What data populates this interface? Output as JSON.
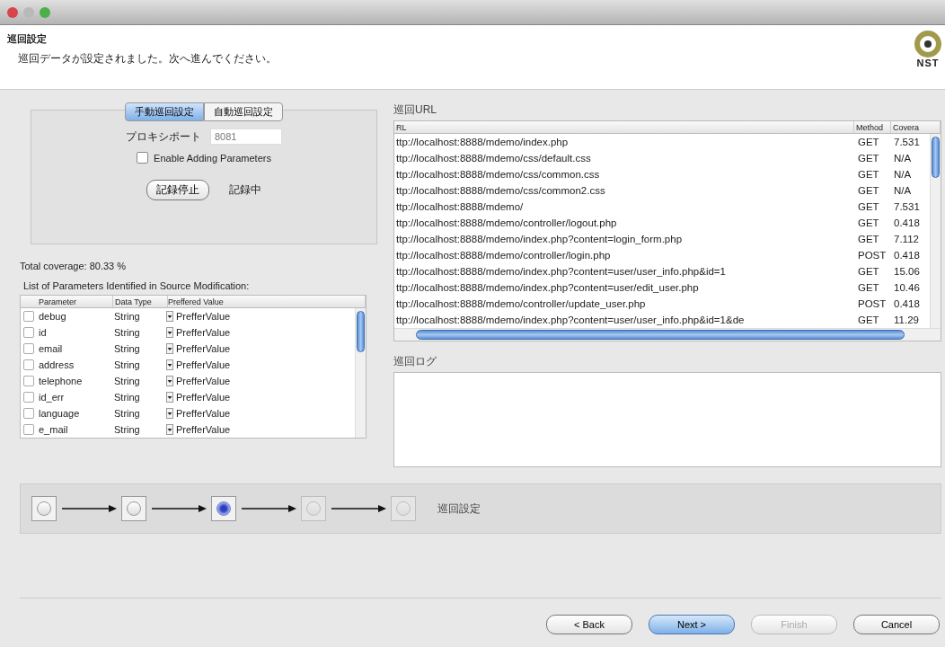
{
  "window": {
    "title_bar_buttons": [
      {
        "kind": "close"
      },
      {
        "kind": "minimize"
      },
      {
        "kind": "zoom"
      }
    ]
  },
  "header": {
    "title": "巡回設定",
    "message": "巡回データが設定されました。次へ進んでください。",
    "logo_text": "NST"
  },
  "tabs": [
    {
      "label": "手動巡回設定",
      "selected": true
    },
    {
      "label": "自動巡回設定",
      "selected": false
    }
  ],
  "proxy": {
    "label": "プロキシポート",
    "value": "8081"
  },
  "enable_params": {
    "label": "Enable Adding Parameters",
    "checked": false
  },
  "record": {
    "button": "記録停止",
    "status": "記録中"
  },
  "total_coverage": "Total coverage: 80.33 %",
  "params_label": "List of Parameters Identified in Source Modification:",
  "params_table": {
    "columns": [
      "Parameter",
      "Data Type",
      "Preffered Value"
    ],
    "rows": [
      {
        "checked": false,
        "name": "debug",
        "type": "String",
        "value": "PrefferValue"
      },
      {
        "checked": false,
        "name": "id",
        "type": "String",
        "value": "PrefferValue"
      },
      {
        "checked": false,
        "name": "email",
        "type": "String",
        "value": "PrefferValue"
      },
      {
        "checked": false,
        "name": "address",
        "type": "String",
        "value": "PrefferValue"
      },
      {
        "checked": false,
        "name": "telephone",
        "type": "String",
        "value": "PrefferValue"
      },
      {
        "checked": false,
        "name": "id_err",
        "type": "String",
        "value": "PrefferValue"
      },
      {
        "checked": false,
        "name": "language",
        "type": "String",
        "value": "PrefferValue"
      },
      {
        "checked": false,
        "name": "e_mail",
        "type": "String",
        "value": "PrefferValue"
      }
    ]
  },
  "url_label": "巡回URL",
  "url_table": {
    "columns": [
      "RL",
      "Method",
      "Covera"
    ],
    "rows": [
      [
        "ttp://localhost:8888/mdemo/index.php",
        "GET",
        "7.531"
      ],
      [
        "ttp://localhost:8888/mdemo/css/default.css",
        "GET",
        "N/A"
      ],
      [
        "ttp://localhost:8888/mdemo/css/common.css",
        "GET",
        "N/A"
      ],
      [
        "ttp://localhost:8888/mdemo/css/common2.css",
        "GET",
        "N/A"
      ],
      [
        "ttp://localhost:8888/mdemo/",
        "GET",
        "7.531"
      ],
      [
        "ttp://localhost:8888/mdemo/controller/logout.php",
        "GET",
        "0.418"
      ],
      [
        "ttp://localhost:8888/mdemo/index.php?content=login_form.php",
        "GET",
        "7.112"
      ],
      [
        "ttp://localhost:8888/mdemo/controller/login.php",
        "POST",
        "0.418"
      ],
      [
        "ttp://localhost:8888/mdemo/index.php?content=user/user_info.php&id=1",
        "GET",
        "15.06"
      ],
      [
        "ttp://localhost:8888/mdemo/index.php?content=user/edit_user.php",
        "GET",
        "10.46"
      ],
      [
        "ttp://localhost:8888/mdemo/controller/update_user.php",
        "POST",
        "0.418"
      ],
      [
        "ttp://localhost:8888/mdemo/index.php?content=user/user_info.php&id=1&de",
        "GET",
        "11.29"
      ]
    ]
  },
  "log_label": "巡回ログ",
  "steps": [
    {
      "selected": false,
      "disabled": false
    },
    {
      "selected": false,
      "disabled": false
    },
    {
      "selected": true,
      "disabled": false
    },
    {
      "selected": false,
      "disabled": true
    },
    {
      "selected": false,
      "disabled": true
    }
  ],
  "step_label": "巡回設定",
  "buttons": [
    {
      "label": "< Back",
      "default": false,
      "disabled": false
    },
    {
      "label": "Next >",
      "default": true,
      "disabled": false
    },
    {
      "label": "Finish",
      "default": false,
      "disabled": true
    },
    {
      "label": "Cancel",
      "default": false,
      "disabled": false
    }
  ]
}
